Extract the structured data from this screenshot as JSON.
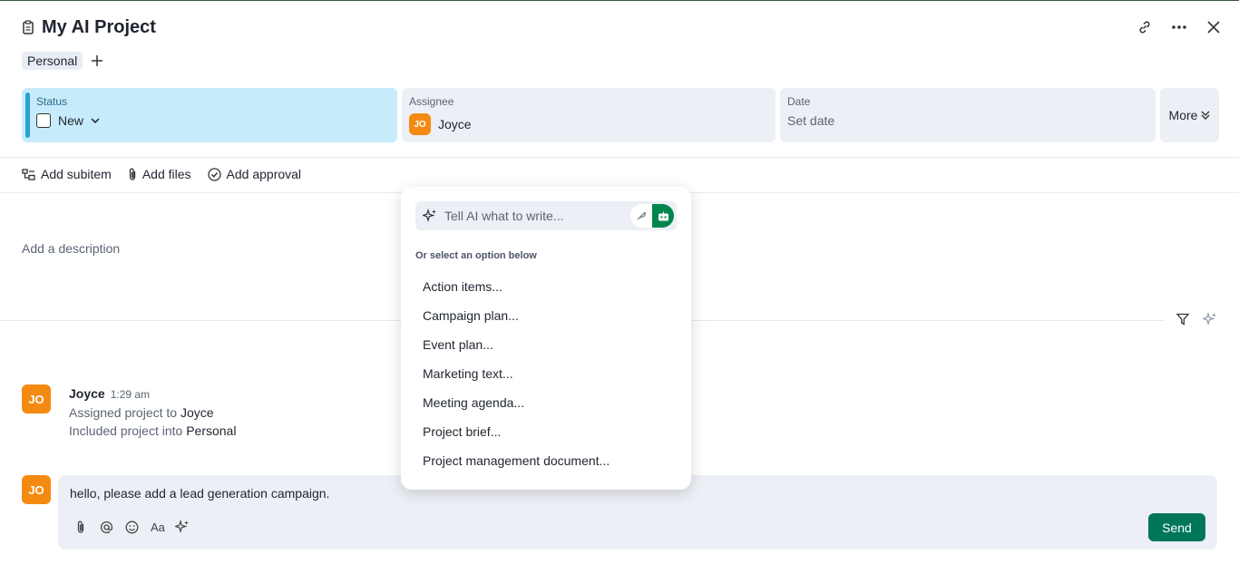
{
  "header": {
    "title": "My AI Project"
  },
  "tags": [
    "Personal"
  ],
  "fields": {
    "status": {
      "label": "Status",
      "value": "New"
    },
    "assignee": {
      "label": "Assignee",
      "value": "Joyce",
      "initials": "JO"
    },
    "date": {
      "label": "Date",
      "value": "Set date"
    },
    "more": {
      "label": "More"
    }
  },
  "toolbar": {
    "add_subitem": "Add subitem",
    "add_files": "Add files",
    "add_approval": "Add approval"
  },
  "description": {
    "placeholder": "Add a description"
  },
  "activity": {
    "initials": "JO",
    "author": "Joyce",
    "time": "1:29 am",
    "line1_prefix": "Assigned project to",
    "line1_target": "Joyce",
    "line2_prefix": "Included project into",
    "line2_target": "Personal"
  },
  "composer": {
    "initials": "JO",
    "text": "hello, please add a lead generation campaign.",
    "format_label": "Aa",
    "send_label": "Send"
  },
  "ai_popup": {
    "placeholder": "Tell AI what to write...",
    "subtitle": "Or select an option below",
    "options": [
      "Action items...",
      "Campaign plan...",
      "Event plan...",
      "Marketing text...",
      "Meeting agenda...",
      "Project brief...",
      "Project management document..."
    ]
  },
  "colors": {
    "status_bg": "#c6ecfb",
    "avatar": "#f58a12",
    "send": "#00775a",
    "ai_toggle": "#00854d"
  },
  "icons": [
    "clipboard-icon",
    "link-icon",
    "ellipsis-icon",
    "close-icon",
    "plus-icon",
    "chevron-down-icon",
    "subitem-icon",
    "paperclip-icon",
    "check-circle-icon",
    "filter-icon",
    "sparkle-icon",
    "at-icon",
    "emoji-icon",
    "feather-icon",
    "robot-icon"
  ]
}
